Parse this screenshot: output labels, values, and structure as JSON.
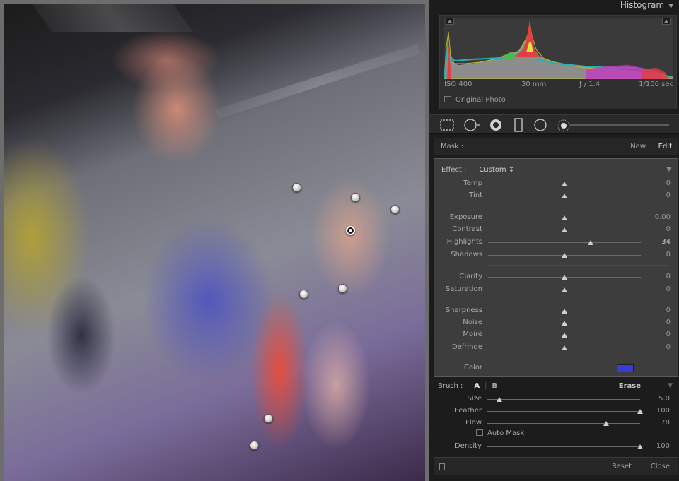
{
  "panel_title": "Histogram",
  "histogram": {
    "iso": "ISO 400",
    "focal_length": "30 mm",
    "aperture": "ƒ / 1.4",
    "shutter": "1/100 sec",
    "original_photo_label": "Original Photo"
  },
  "tools": [
    "crop-overlay-icon",
    "spot-removal-icon",
    "red-eye-icon",
    "graduated-filter-icon",
    "radial-filter-icon",
    "adjustment-brush-icon"
  ],
  "mask": {
    "label": "Mask :",
    "new_label": "New",
    "edit_label": "Edit"
  },
  "effect": {
    "label": "Effect :",
    "value": "Custom ↕",
    "sliders": [
      {
        "name": "Temp",
        "value": "0",
        "pos": 0.5,
        "gradient": "linear-gradient(90deg,#3a4fd0,#d8d840)"
      },
      {
        "name": "Tint",
        "value": "0",
        "pos": 0.5,
        "gradient": "linear-gradient(90deg,#3fbf3f,#c040c0)"
      },
      {
        "name": "Exposure",
        "value": "0.00",
        "pos": 0.5
      },
      {
        "name": "Contrast",
        "value": "0",
        "pos": 0.5
      },
      {
        "name": "Highlights",
        "value": "34",
        "pos": 0.67,
        "highlight": true
      },
      {
        "name": "Shadows",
        "value": "0",
        "pos": 0.5
      },
      {
        "name": "Clarity",
        "value": "0",
        "pos": 0.5
      },
      {
        "name": "Saturation",
        "value": "0",
        "pos": 0.5,
        "gradient": "linear-gradient(90deg,#808080,#50b050,#4060c0,#c04040)"
      },
      {
        "name": "Sharpness",
        "value": "0",
        "pos": 0.5,
        "gradient": "linear-gradient(90deg,#6a6a6a,#b04040)"
      },
      {
        "name": "Noise",
        "value": "0",
        "pos": 0.5
      },
      {
        "name": "Moiré",
        "value": "0",
        "pos": 0.5
      },
      {
        "name": "Defringe",
        "value": "0",
        "pos": 0.5
      }
    ],
    "color_label": "Color",
    "color_swatch": "#3b3bd6"
  },
  "brush": {
    "label": "Brush :",
    "a_label": "A",
    "b_label": "B",
    "erase_label": "Erase",
    "sliders": [
      {
        "name": "Size",
        "value": "5.0",
        "pos": 0.08
      },
      {
        "name": "Feather",
        "value": "100",
        "pos": 1.0
      },
      {
        "name": "Flow",
        "value": "78",
        "pos": 0.78
      }
    ],
    "auto_mask_label": "Auto Mask",
    "density": {
      "name": "Density",
      "value": "100",
      "pos": 1.0
    }
  },
  "footer": {
    "reset_label": "Reset",
    "close_label": "Close"
  },
  "colors": {
    "accent": "#3b3bd6",
    "panel_bg": "#1c1c1c",
    "section_bg": "#3d3d3d"
  }
}
